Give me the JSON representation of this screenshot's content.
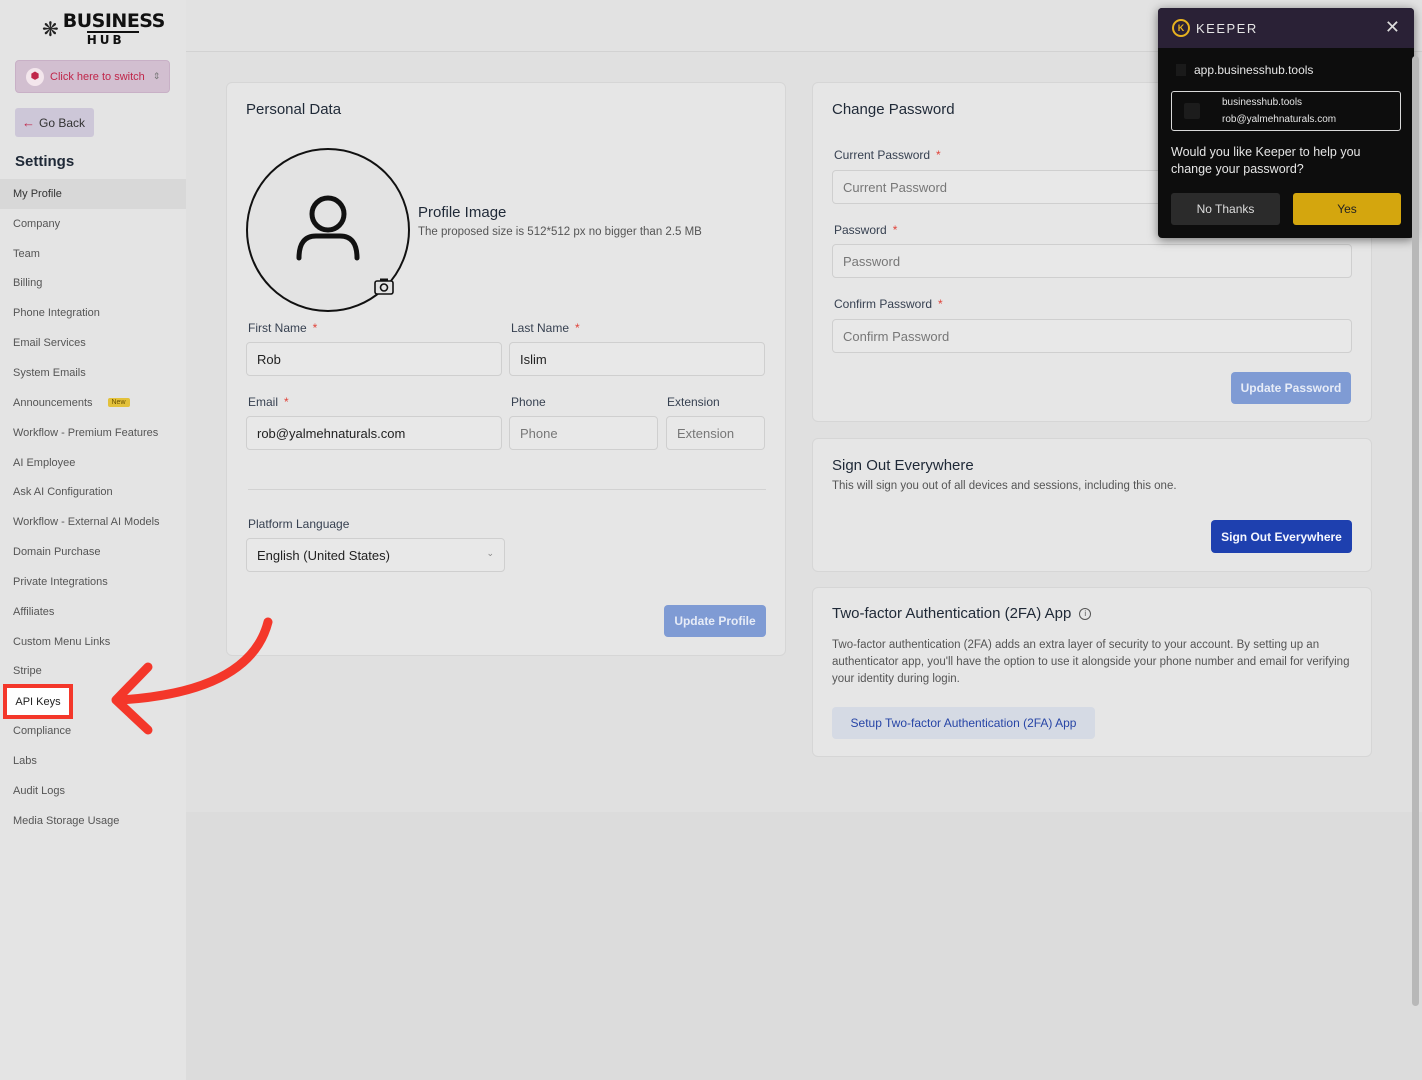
{
  "brand": {
    "line1": "BUSINESS",
    "line2": "HUB"
  },
  "switcher": {
    "label": "Click here to switch"
  },
  "go_back": {
    "label": "Go Back"
  },
  "settings": {
    "title": "Settings",
    "nav": [
      {
        "label": "My Profile",
        "active": true
      },
      {
        "label": "Company"
      },
      {
        "label": "Team"
      },
      {
        "label": "Billing"
      },
      {
        "label": "Phone Integration"
      },
      {
        "label": "Email Services"
      },
      {
        "label": "System Emails"
      },
      {
        "label": "Announcements",
        "badge": "New"
      },
      {
        "label": "Workflow - Premium Features"
      },
      {
        "label": "AI Employee"
      },
      {
        "label": "Ask AI Configuration"
      },
      {
        "label": "Workflow - External AI Models"
      },
      {
        "label": "Domain Purchase"
      },
      {
        "label": "Private Integrations"
      },
      {
        "label": "Affiliates"
      },
      {
        "label": "Custom Menu Links"
      },
      {
        "label": "Stripe"
      },
      {
        "label": "API Keys",
        "highlighted": true
      },
      {
        "label": "Compliance"
      },
      {
        "label": "Labs"
      },
      {
        "label": "Audit Logs"
      },
      {
        "label": "Media Storage Usage"
      }
    ]
  },
  "personal_data": {
    "title": "Personal Data",
    "profile_image_title": "Profile Image",
    "profile_image_hint": "The proposed size is 512*512 px no bigger than 2.5 MB",
    "first_name_label": "First Name",
    "first_name_value": "Rob",
    "last_name_label": "Last Name",
    "last_name_value": "Islim",
    "email_label": "Email",
    "email_value": "rob@yalmehnaturals.com",
    "phone_label": "Phone",
    "phone_placeholder": "Phone",
    "extension_label": "Extension",
    "extension_placeholder": "Extension",
    "language_label": "Platform Language",
    "language_value": "English (United States)",
    "update_button": "Update Profile",
    "required_mark": "*"
  },
  "change_password": {
    "title": "Change Password",
    "current_label": "Current Password",
    "current_placeholder": "Current Password",
    "password_label": "Password",
    "password_placeholder": "Password",
    "confirm_label": "Confirm Password",
    "confirm_placeholder": "Confirm Password",
    "update_button": "Update Password"
  },
  "sign_out": {
    "title": "Sign Out Everywhere",
    "description": "This will sign you out of all devices and sessions, including this one.",
    "button": "Sign Out Everywhere"
  },
  "two_factor": {
    "title": "Two-factor Authentication (2FA) App",
    "description": "Two-factor authentication (2FA) adds an extra layer of security to your account. By setting up an authenticator app, you'll have the option to use it alongside your phone number and email for verifying your identity during login.",
    "button": "Setup Two-factor Authentication (2FA) App"
  },
  "keeper": {
    "brand": "KEEPER",
    "site": "app.businesshub.tools",
    "account_site": "businesshub.tools",
    "account_email": "rob@yalmehnaturals.com",
    "question": "Would you like Keeper to help you change your password?",
    "no_button": "No Thanks",
    "yes_button": "Yes"
  },
  "colors": {
    "highlight_red": "#f4372a",
    "keeper_yellow": "#d4a60e",
    "primary_blue": "#1e40af"
  }
}
